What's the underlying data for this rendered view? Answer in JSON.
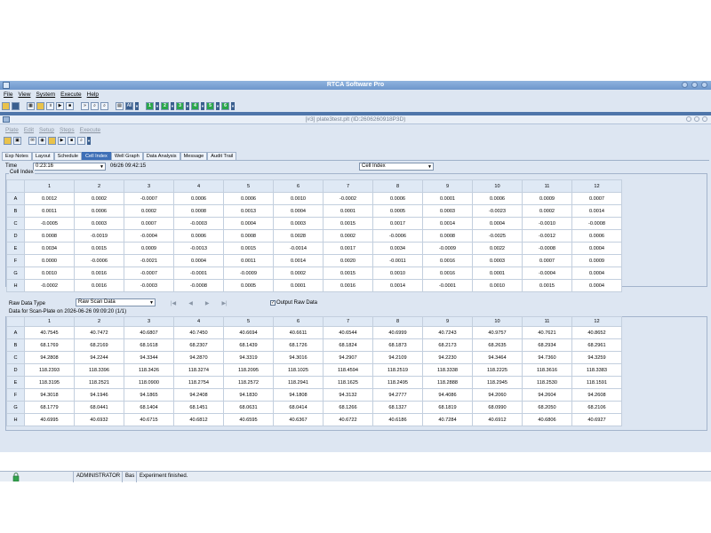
{
  "app": {
    "title": "RTCA Software Pro",
    "menu": [
      "File",
      "View",
      "System",
      "Execute",
      "Help"
    ]
  },
  "toolbar": {
    "buttons": [
      "save-icon",
      "print-icon",
      "pause-icon",
      "play-icon",
      "stop-icon",
      "zoom-in-icon",
      "zoom-out-icon"
    ],
    "all_label": "All",
    "station_labels": [
      "1",
      "2",
      "3",
      "4",
      "5",
      "6"
    ]
  },
  "child": {
    "title": "[#3] plate3test.plt (ID:2606260918P3D)",
    "menu": [
      "Plate",
      "Edit",
      "Setup",
      "Steps",
      "Execute"
    ]
  },
  "tabs": [
    "Exp Notes",
    "Layout",
    "Schedule",
    "Cell Index",
    "Well Graph",
    "Data Analysis",
    "Message",
    "Audit Trail"
  ],
  "active_tab": "Cell Index",
  "cell_index": {
    "time_label": "Time",
    "time_value": "0:23:16",
    "timestamp": "06/26 09:42:15",
    "type_value": "Cell Index",
    "group_label": "Cell Index",
    "columns": [
      "1",
      "2",
      "3",
      "4",
      "5",
      "6",
      "7",
      "8",
      "9",
      "10",
      "11",
      "12"
    ],
    "rows": [
      {
        "label": "A",
        "values": [
          "0.0012",
          "0.0002",
          "-0.0007",
          "0.0006",
          "0.0006",
          "0.0010",
          "-0.0002",
          "0.0006",
          "0.0001",
          "0.0006",
          "0.0009",
          "0.0007"
        ]
      },
      {
        "label": "B",
        "values": [
          "0.0011",
          "0.0006",
          "0.0002",
          "0.0008",
          "0.0013",
          "0.0004",
          "0.0001",
          "0.0005",
          "0.0003",
          "-0.0023",
          "0.0002",
          "0.0014"
        ]
      },
      {
        "label": "C",
        "values": [
          "-0.0005",
          "0.0003",
          "0.0007",
          "-0.0003",
          "0.0004",
          "0.0003",
          "0.0015",
          "0.0017",
          "0.0014",
          "0.0004",
          "-0.0010",
          "-0.0008"
        ]
      },
      {
        "label": "D",
        "values": [
          "0.0008",
          "-0.0019",
          "-0.0004",
          "0.0006",
          "0.0008",
          "0.0028",
          "0.0002",
          "-0.0006",
          "0.0008",
          "-0.0025",
          "-0.0012",
          "0.0006"
        ]
      },
      {
        "label": "E",
        "values": [
          "0.0034",
          "0.0015",
          "0.0009",
          "-0.0013",
          "0.0015",
          "-0.0014",
          "0.0017",
          "0.0034",
          "-0.0009",
          "0.0022",
          "-0.0008",
          "0.0004"
        ]
      },
      {
        "label": "F",
        "values": [
          "0.0000",
          "-0.0006",
          "-0.0021",
          "0.0004",
          "0.0011",
          "0.0014",
          "0.0020",
          "-0.0011",
          "0.0016",
          "0.0003",
          "0.0007",
          "0.0009"
        ]
      },
      {
        "label": "G",
        "values": [
          "0.0010",
          "0.0016",
          "-0.0007",
          "-0.0001",
          "-0.0009",
          "0.0002",
          "0.0015",
          "0.0010",
          "0.0016",
          "0.0001",
          "-0.0004",
          "0.0004"
        ]
      },
      {
        "label": "H",
        "values": [
          "-0.0002",
          "0.0016",
          "-0.0003",
          "-0.0008",
          "0.0005",
          "0.0001",
          "0.0016",
          "0.0014",
          "-0.0001",
          "0.0010",
          "0.0015",
          "0.0004"
        ]
      }
    ]
  },
  "raw": {
    "type_label": "Raw Data Type",
    "type_value": "Raw Scan Data",
    "nav": [
      "|◀",
      "◀",
      "▶",
      "▶|"
    ],
    "output_label": "Output Raw Data",
    "output_checked": "✓",
    "scan_caption": "Data for Scan-Plate on 2026-06-26 09:09:20 (1/1)",
    "columns": [
      "1",
      "2",
      "3",
      "4",
      "5",
      "6",
      "7",
      "8",
      "9",
      "10",
      "11",
      "12"
    ],
    "rows": [
      {
        "label": "A",
        "values": [
          "40.7545",
          "40.7472",
          "40.6807",
          "40.7450",
          "40.6694",
          "40.6611",
          "40.6544",
          "40.6999",
          "40.7243",
          "40.9757",
          "40.7621",
          "40.8652"
        ]
      },
      {
        "label": "B",
        "values": [
          "68.1769",
          "68.2169",
          "68.1618",
          "68.2307",
          "68.1439",
          "68.1726",
          "68.1824",
          "68.1873",
          "68.2173",
          "68.2635",
          "68.2934",
          "68.2961"
        ]
      },
      {
        "label": "C",
        "values": [
          "94.2808",
          "94.2244",
          "94.3344",
          "94.2870",
          "94.3319",
          "94.3016",
          "94.2907",
          "94.2109",
          "94.2230",
          "94.3464",
          "94.7360",
          "94.3259"
        ]
      },
      {
        "label": "D",
        "values": [
          "118.2393",
          "118.3396",
          "118.3426",
          "118.3274",
          "118.2095",
          "118.1025",
          "118.4594",
          "118.2519",
          "118.3338",
          "118.2225",
          "118.3616",
          "118.3383"
        ]
      },
      {
        "label": "E",
        "values": [
          "118.3195",
          "118.2521",
          "118.0900",
          "118.2754",
          "118.2572",
          "118.2941",
          "118.1625",
          "118.2495",
          "118.2888",
          "118.2945",
          "118.2530",
          "118.1591"
        ]
      },
      {
        "label": "F",
        "values": [
          "94.3018",
          "94.1946",
          "94.1865",
          "94.2408",
          "94.1830",
          "94.1808",
          "94.3132",
          "94.2777",
          "94.4086",
          "94.2060",
          "94.2604",
          "94.2608"
        ]
      },
      {
        "label": "G",
        "values": [
          "68.1779",
          "68.0441",
          "68.1404",
          "68.1451",
          "68.0631",
          "68.0414",
          "68.1266",
          "68.1327",
          "68.1819",
          "68.0990",
          "68.2050",
          "68.2106"
        ]
      },
      {
        "label": "H",
        "values": [
          "40.6995",
          "40.6932",
          "40.6715",
          "40.6812",
          "40.6595",
          "40.6367",
          "40.6722",
          "40.6186",
          "40.7284",
          "40.6912",
          "40.6806",
          "40.6927"
        ]
      }
    ]
  },
  "status": {
    "user": "ADMINISTRATOR",
    "role": "Bas",
    "message": "Experiment finished."
  }
}
